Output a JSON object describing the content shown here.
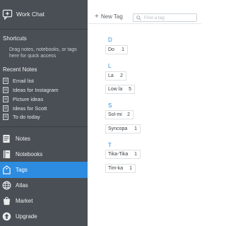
{
  "sidebar": {
    "workchat": {
      "label": "Work Chat",
      "icon": "chat-bubble-icon"
    },
    "shortcuts": {
      "title": "Shortcuts",
      "hint": "Drag notes, notebooks, or tags here for quick access"
    },
    "recent_notes": {
      "title": "Recent Notes",
      "items": [
        {
          "label": "Email list"
        },
        {
          "label": "Ideas for Instagram"
        },
        {
          "label": "Picture ideas"
        },
        {
          "label": "Ideas for Scott"
        },
        {
          "label": "To do today"
        }
      ]
    },
    "nav": [
      {
        "label": "Notes",
        "icon": "notes-icon"
      },
      {
        "label": "Notebooks",
        "icon": "notebook-icon"
      },
      {
        "label": "Tags",
        "icon": "tag-icon",
        "active": true
      },
      {
        "label": "Atlas",
        "icon": "globe-icon"
      },
      {
        "label": "Market",
        "icon": "market-icon"
      },
      {
        "label": "Upgrade",
        "icon": "upgrade-icon"
      }
    ]
  },
  "toolbar": {
    "new_tag_label": "New Tag",
    "search_placeholder": "Find a tag"
  },
  "tags": {
    "groups": [
      {
        "letter": "D",
        "items": [
          {
            "name": "Do",
            "count": "1"
          }
        ]
      },
      {
        "letter": "L",
        "items": [
          {
            "name": "La",
            "count": "2"
          },
          {
            "name": "Low la",
            "count": "5"
          }
        ]
      },
      {
        "letter": "S",
        "items": [
          {
            "name": "Sol-mi",
            "count": "2"
          },
          {
            "name": "Syncopa",
            "count": "1"
          }
        ]
      },
      {
        "letter": "T",
        "items": [
          {
            "name": "Tika-Tika",
            "count": "1"
          },
          {
            "name": "Tim-ka",
            "count": "1"
          }
        ]
      }
    ]
  },
  "colors": {
    "sidebar_bg": "#4a4f55",
    "active_bg": "#2d8ce0",
    "letter": "#2d8ce0"
  }
}
